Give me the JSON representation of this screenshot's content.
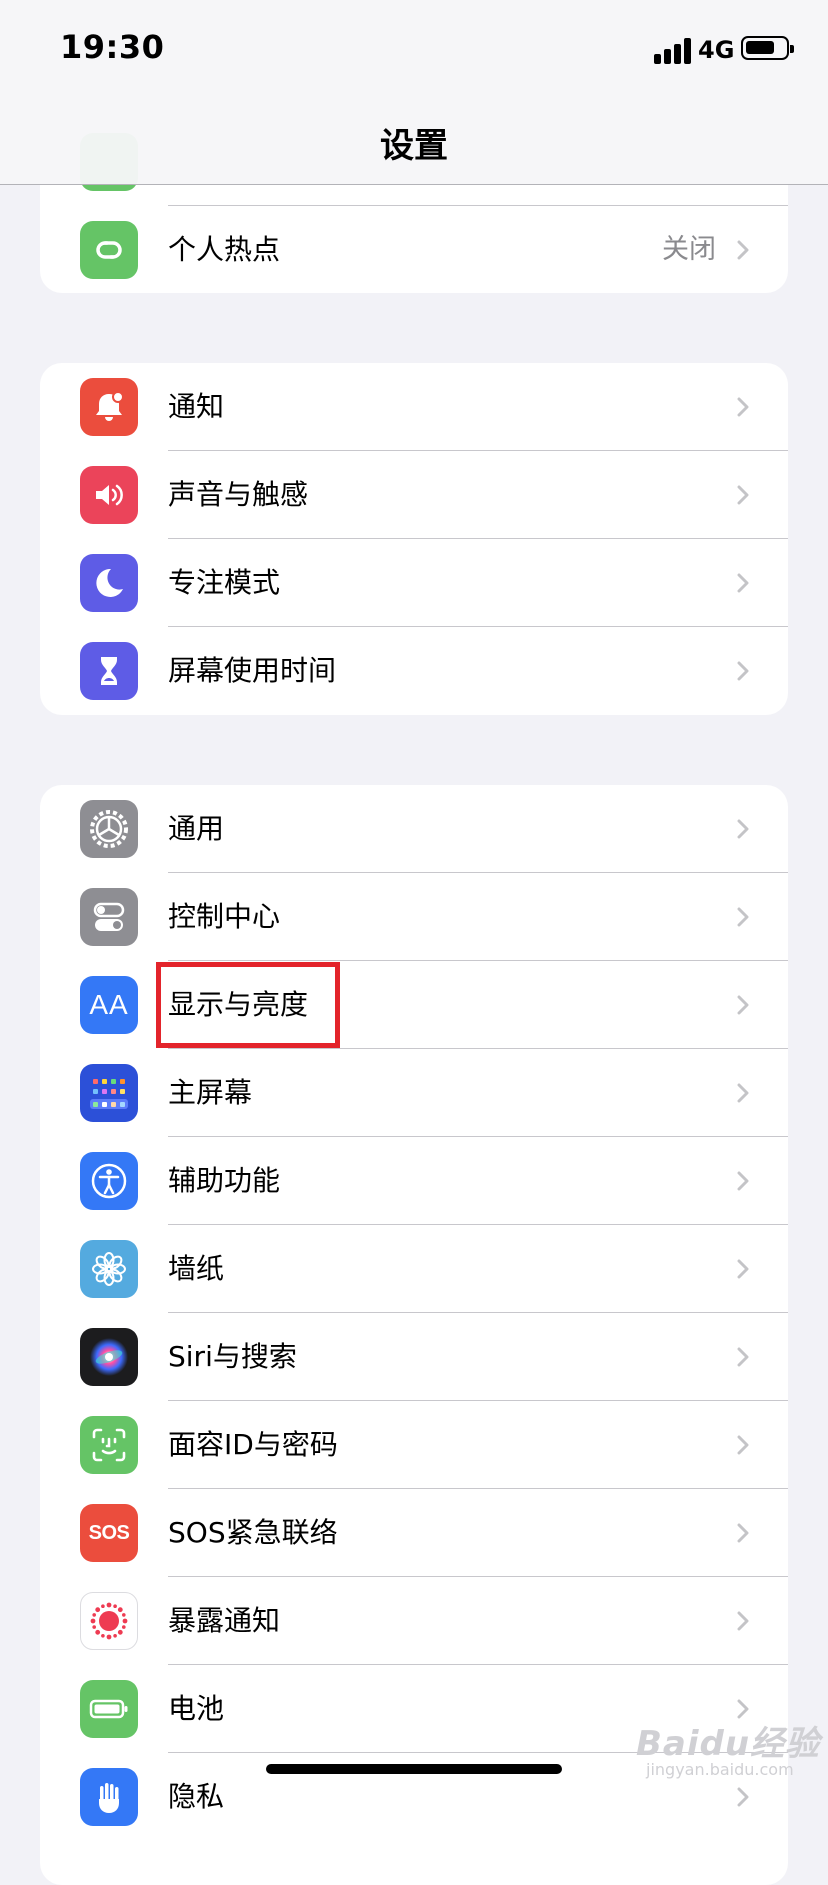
{
  "status_bar": {
    "time": "19:30",
    "network": "4G"
  },
  "nav": {
    "title": "设置"
  },
  "group0": {
    "items": [
      {
        "label": "个人热点",
        "value": "关闭",
        "icon": "hotspot-icon",
        "color": "#65c466"
      }
    ]
  },
  "group1": {
    "items": [
      {
        "label": "通知",
        "icon": "notification-bell-icon",
        "color": "#eb4d3d"
      },
      {
        "label": "声音与触感",
        "icon": "speaker-icon",
        "color": "#eb445a"
      },
      {
        "label": "专注模式",
        "icon": "moon-icon",
        "color": "#5e5ce6"
      },
      {
        "label": "屏幕使用时间",
        "icon": "hourglass-icon",
        "color": "#5e5ce6"
      }
    ]
  },
  "group2": {
    "items": [
      {
        "label": "通用",
        "icon": "gear-icon",
        "color": "#8e8e93"
      },
      {
        "label": "控制中心",
        "icon": "toggle-switches-icon",
        "color": "#8e8e93"
      },
      {
        "label": "显示与亮度",
        "icon": "text-size-aa-icon",
        "color": "#3478f6"
      },
      {
        "label": "主屏幕",
        "icon": "home-screen-grid-icon",
        "color": "#2c50d8"
      },
      {
        "label": "辅助功能",
        "icon": "accessibility-person-icon",
        "color": "#3478f6"
      },
      {
        "label": "墙纸",
        "icon": "flower-icon",
        "color": "#54aadf"
      },
      {
        "label": "Siri与搜索",
        "icon": "siri-orb-icon",
        "color": "#1c1c1e"
      },
      {
        "label": "面容ID与密码",
        "icon": "face-id-icon",
        "color": "#65c466"
      },
      {
        "label": "SOS紧急联络",
        "icon": "sos-icon",
        "color": "#eb4d3d"
      },
      {
        "label": "暴露通知",
        "icon": "exposure-notification-icon",
        "color": "#ffffff"
      },
      {
        "label": "电池",
        "icon": "battery-icon",
        "color": "#65c466"
      },
      {
        "label": "隐私",
        "icon": "privacy-hand-icon",
        "color": "#3478f6"
      }
    ]
  },
  "icons": {
    "aa_text": "AA",
    "sos_text": "SOS"
  },
  "watermark": {
    "main": "Baidu经验",
    "sub": "jingyan.baidu.com"
  }
}
